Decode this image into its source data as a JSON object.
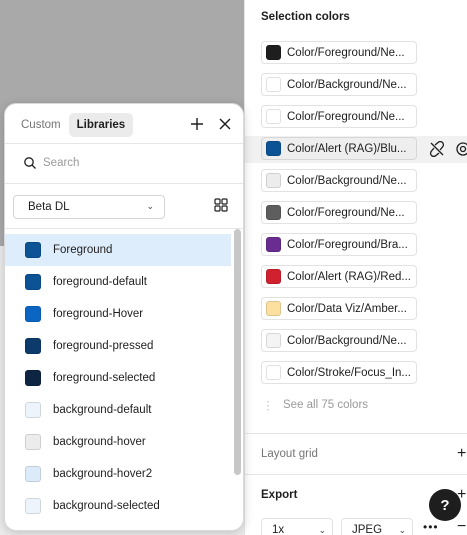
{
  "selection_colors": {
    "title": "Selection colors",
    "items": [
      {
        "label": "Color/Foreground/Ne...",
        "color": "#1e1e1e"
      },
      {
        "label": "Color/Background/Ne...",
        "color": "#ffffff"
      },
      {
        "label": "Color/Foreground/Ne...",
        "color": "#ffffff"
      },
      {
        "label": "Color/Alert (RAG)/Blu...",
        "color": "#0b5394"
      },
      {
        "label": "Color/Background/Ne...",
        "color": "#ececec"
      },
      {
        "label": "Color/Foreground/Ne...",
        "color": "#5e5e5e"
      },
      {
        "label": "Color/Foreground/Bra...",
        "color": "#6a2c91"
      },
      {
        "label": "Color/Alert (RAG)/Red...",
        "color": "#d1212f"
      },
      {
        "label": "Color/Data Viz/Amber...",
        "color": "#fbe0a0"
      },
      {
        "label": "Color/Background/Ne...",
        "color": "#f4f4f4"
      },
      {
        "label": "Color/Stroke/Focus_In...",
        "color": "#ffffff"
      }
    ],
    "see_all": "See all 75 colors"
  },
  "layout_grid": {
    "title": "Layout grid"
  },
  "export": {
    "title": "Export",
    "scale": "1x",
    "format": "JPEG",
    "more": "•••",
    "remove": "−"
  },
  "help": {
    "label": "?"
  },
  "picker": {
    "tabs": [
      "Custom",
      "Libraries"
    ],
    "search_placeholder": "Search",
    "library": "Beta DL",
    "items": [
      {
        "name": "Foreground",
        "color": "#0b5394"
      },
      {
        "name": "foreground-default",
        "color": "#0b5394"
      },
      {
        "name": "foreground-Hover",
        "color": "#0a66c2"
      },
      {
        "name": "foreground-pressed",
        "color": "#0c3b6b"
      },
      {
        "name": "foreground-selected",
        "color": "#0d2542"
      },
      {
        "name": "background-default",
        "color": "#edf4fc"
      },
      {
        "name": "background-hover",
        "color": "#ececec"
      },
      {
        "name": "background-hover2",
        "color": "#dcebfa"
      },
      {
        "name": "background-selected",
        "color": "#edf4fc"
      }
    ]
  },
  "colors": {
    "selected_row": "#deedfb",
    "accent": "#0b5394"
  }
}
